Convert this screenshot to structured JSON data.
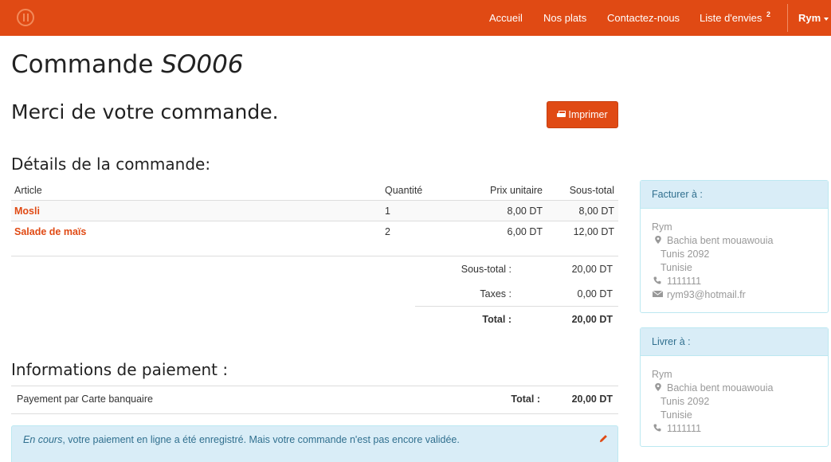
{
  "navbar": {
    "links": [
      "Accueil",
      "Nos plats",
      "Contactez-nous",
      "Liste d'envies"
    ],
    "wishlist_count": "2",
    "user": "Rym",
    "brand_color": "#e04a14"
  },
  "page": {
    "title_prefix": "Commande",
    "order_ref": "SO006",
    "thanks": "Merci de votre commande.",
    "print_label": "Imprimer"
  },
  "details": {
    "title": "Détails de la commande:",
    "columns": [
      "Article",
      "Quantité",
      "Prix unitaire",
      "Sous-total"
    ],
    "rows": [
      {
        "article": "Mosli",
        "qty": "1",
        "unit": "8,00 DT",
        "subtotal": "8,00 DT"
      },
      {
        "article": "Salade de maïs",
        "qty": "2",
        "unit": "6,00 DT",
        "subtotal": "12,00 DT"
      }
    ],
    "subtotal_label": "Sous-total :",
    "subtotal_value": "20,00 DT",
    "taxes_label": "Taxes :",
    "taxes_value": "0,00 DT",
    "total_label": "Total :",
    "total_value": "20,00 DT"
  },
  "payment": {
    "title": "Informations de paiement :",
    "method": "Payement par Carte banquaire",
    "total_label": "Total :",
    "total_value": "20,00 DT",
    "status_em": "En cours",
    "status_text": ", votre paiement en ligne a été enregistré. Mais votre commande n'est pas encore validée."
  },
  "billing": {
    "title": "Facturer à :",
    "name": "Rym",
    "street": "Bachia bent mouawouia",
    "city": "Tunis 2092",
    "country": "Tunisie",
    "phone": "1111111",
    "email": "rym93@hotmail.fr"
  },
  "shipping": {
    "title": "Livrer à :",
    "name": "Rym",
    "street": "Bachia bent mouawouia",
    "city": "Tunis 2092",
    "country": "Tunisie",
    "phone": "1111111"
  }
}
